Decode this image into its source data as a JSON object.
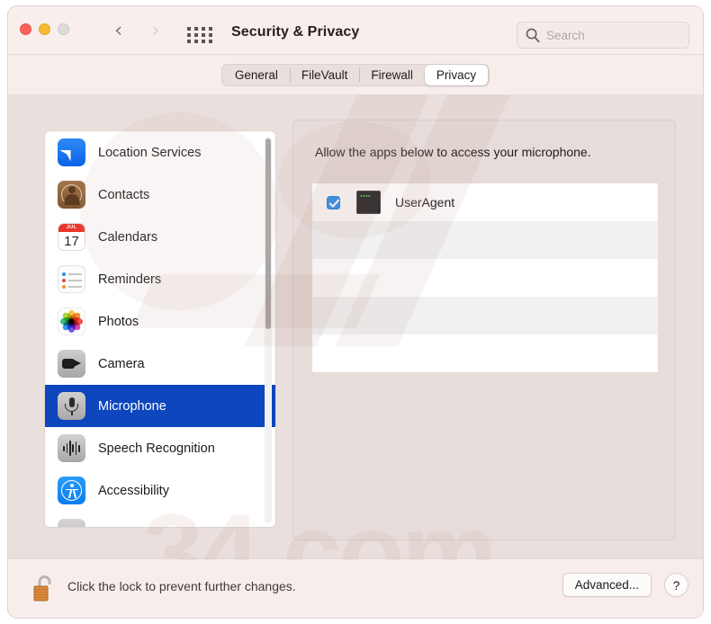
{
  "window": {
    "title": "Security & Privacy",
    "traffic_lights": [
      "close",
      "minimize",
      "zoom"
    ],
    "nav": {
      "back_icon": "chevron-left-icon",
      "forward_icon": "chevron-right-icon"
    },
    "show_all_icon": "grid-apps-icon"
  },
  "search": {
    "placeholder": "Search",
    "value": "",
    "icon": "search-icon"
  },
  "tabs": [
    {
      "label": "General",
      "active": false
    },
    {
      "label": "FileVault",
      "active": false
    },
    {
      "label": "Firewall",
      "active": false
    },
    {
      "label": "Privacy",
      "active": true
    }
  ],
  "sidebar": {
    "items": [
      {
        "label": "Location Services",
        "icon": "location-services-icon",
        "selected": false
      },
      {
        "label": "Contacts",
        "icon": "contacts-icon",
        "selected": false
      },
      {
        "label": "Calendars",
        "icon": "calendar-icon",
        "selected": false
      },
      {
        "label": "Reminders",
        "icon": "reminders-icon",
        "selected": false
      },
      {
        "label": "Photos",
        "icon": "photos-icon",
        "selected": false
      },
      {
        "label": "Camera",
        "icon": "camera-icon",
        "selected": false
      },
      {
        "label": "Microphone",
        "icon": "microphone-icon",
        "selected": true
      },
      {
        "label": "Speech Recognition",
        "icon": "speech-recognition-icon",
        "selected": false
      },
      {
        "label": "Accessibility",
        "icon": "accessibility-icon",
        "selected": false
      }
    ],
    "calendar_icon": {
      "month": "JUL",
      "day": "17"
    },
    "scrollbar": {
      "visible": true
    }
  },
  "panel": {
    "description": "Allow the apps below to access your microphone.",
    "apps": [
      {
        "name": "UserAgent",
        "checked": true,
        "icon": "terminal-app-icon"
      }
    ]
  },
  "footer": {
    "lock_icon": "unlocked-padlock-icon",
    "lock_note": "Click the lock to prevent further changes.",
    "advanced_label": "Advanced...",
    "help_label": "?"
  },
  "colors": {
    "selection_blue": "#0d46bd",
    "checkbox_blue": "#1e8af4",
    "window_chrome": "#f7eeec",
    "content_bg": "#e9dfdd",
    "panel_bg": "#e6dcda"
  }
}
